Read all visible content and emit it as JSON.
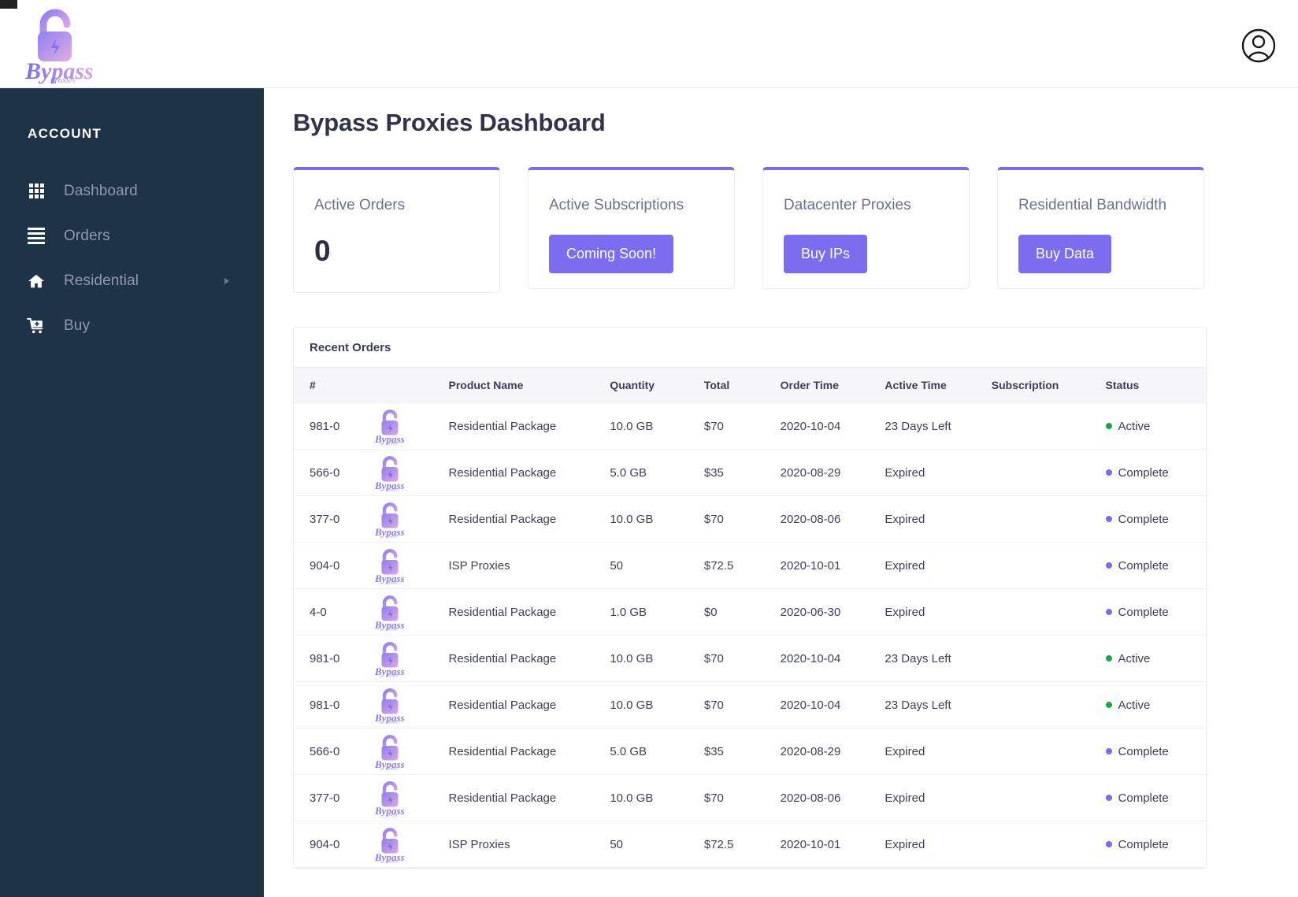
{
  "brand": {
    "name": "Bypass",
    "sub": "proxies",
    "logo_icon": "padlock-bolt-logo"
  },
  "topbar": {
    "avatar_icon": "user-circle-icon"
  },
  "sidebar": {
    "title": "ACCOUNT",
    "items": [
      {
        "label": "Dashboard",
        "icon": "grid-icon",
        "caret": false
      },
      {
        "label": "Orders",
        "icon": "list-icon",
        "caret": false
      },
      {
        "label": "Residential",
        "icon": "home-icon",
        "caret": true
      },
      {
        "label": "Buy",
        "icon": "cart-plus-icon",
        "caret": false
      }
    ]
  },
  "main": {
    "page_title": "Bypass Proxies Dashboard",
    "cards": [
      {
        "title": "Active Orders",
        "value": "0",
        "button": null
      },
      {
        "title": "Active Subscriptions",
        "value": null,
        "button": "Coming Soon!"
      },
      {
        "title": "Datacenter Proxies",
        "value": null,
        "button": "Buy IPs"
      },
      {
        "title": "Residential Bandwidth",
        "value": null,
        "button": "Buy Data"
      }
    ],
    "orders": {
      "section_title": "Recent Orders",
      "columns": [
        "#",
        "",
        "Product Name",
        "Quantity",
        "Total",
        "Order Time",
        "Active Time",
        "Subscription",
        "Status"
      ],
      "rows": [
        {
          "id": "981-0",
          "product": "Residential Package",
          "quantity": "10.0 GB",
          "total": "$70",
          "order_time": "2020-10-04",
          "active_time": "23 Days Left",
          "subscription": "",
          "status": "Active",
          "status_color": "green"
        },
        {
          "id": "566-0",
          "product": "Residential Package",
          "quantity": "5.0 GB",
          "total": "$35",
          "order_time": "2020-08-29",
          "active_time": "Expired",
          "subscription": "",
          "status": "Complete",
          "status_color": "purple"
        },
        {
          "id": "377-0",
          "product": "Residential Package",
          "quantity": "10.0 GB",
          "total": "$70",
          "order_time": "2020-08-06",
          "active_time": "Expired",
          "subscription": "",
          "status": "Complete",
          "status_color": "purple"
        },
        {
          "id": "904-0",
          "product": "ISP Proxies",
          "quantity": "50",
          "total": "$72.5",
          "order_time": "2020-10-01",
          "active_time": "Expired",
          "subscription": "",
          "status": "Complete",
          "status_color": "purple"
        },
        {
          "id": "4-0",
          "product": "Residential Package",
          "quantity": "1.0 GB",
          "total": "$0",
          "order_time": "2020-06-30",
          "active_time": "Expired",
          "subscription": "",
          "status": "Complete",
          "status_color": "purple"
        },
        {
          "id": "981-0",
          "product": "Residential Package",
          "quantity": "10.0 GB",
          "total": "$70",
          "order_time": "2020-10-04",
          "active_time": "23 Days Left",
          "subscription": "",
          "status": "Active",
          "status_color": "green"
        },
        {
          "id": "981-0",
          "product": "Residential Package",
          "quantity": "10.0 GB",
          "total": "$70",
          "order_time": "2020-10-04",
          "active_time": "23 Days Left",
          "subscription": "",
          "status": "Active",
          "status_color": "green"
        },
        {
          "id": "566-0",
          "product": "Residential Package",
          "quantity": "5.0 GB",
          "total": "$35",
          "order_time": "2020-08-29",
          "active_time": "Expired",
          "subscription": "",
          "status": "Complete",
          "status_color": "purple"
        },
        {
          "id": "377-0",
          "product": "Residential Package",
          "quantity": "10.0 GB",
          "total": "$70",
          "order_time": "2020-08-06",
          "active_time": "Expired",
          "subscription": "",
          "status": "Complete",
          "status_color": "purple"
        },
        {
          "id": "904-0",
          "product": "ISP Proxies",
          "quantity": "50",
          "total": "$72.5",
          "order_time": "2020-10-01",
          "active_time": "Expired",
          "subscription": "",
          "status": "Complete",
          "status_color": "purple"
        }
      ]
    }
  },
  "colors": {
    "accent_purple": "#7b6cf0",
    "sidebar_navy": "#1e3346",
    "status_active_green": "#19a74a",
    "status_complete_purple": "#7b6cf0",
    "title_dark": "#32334a"
  }
}
